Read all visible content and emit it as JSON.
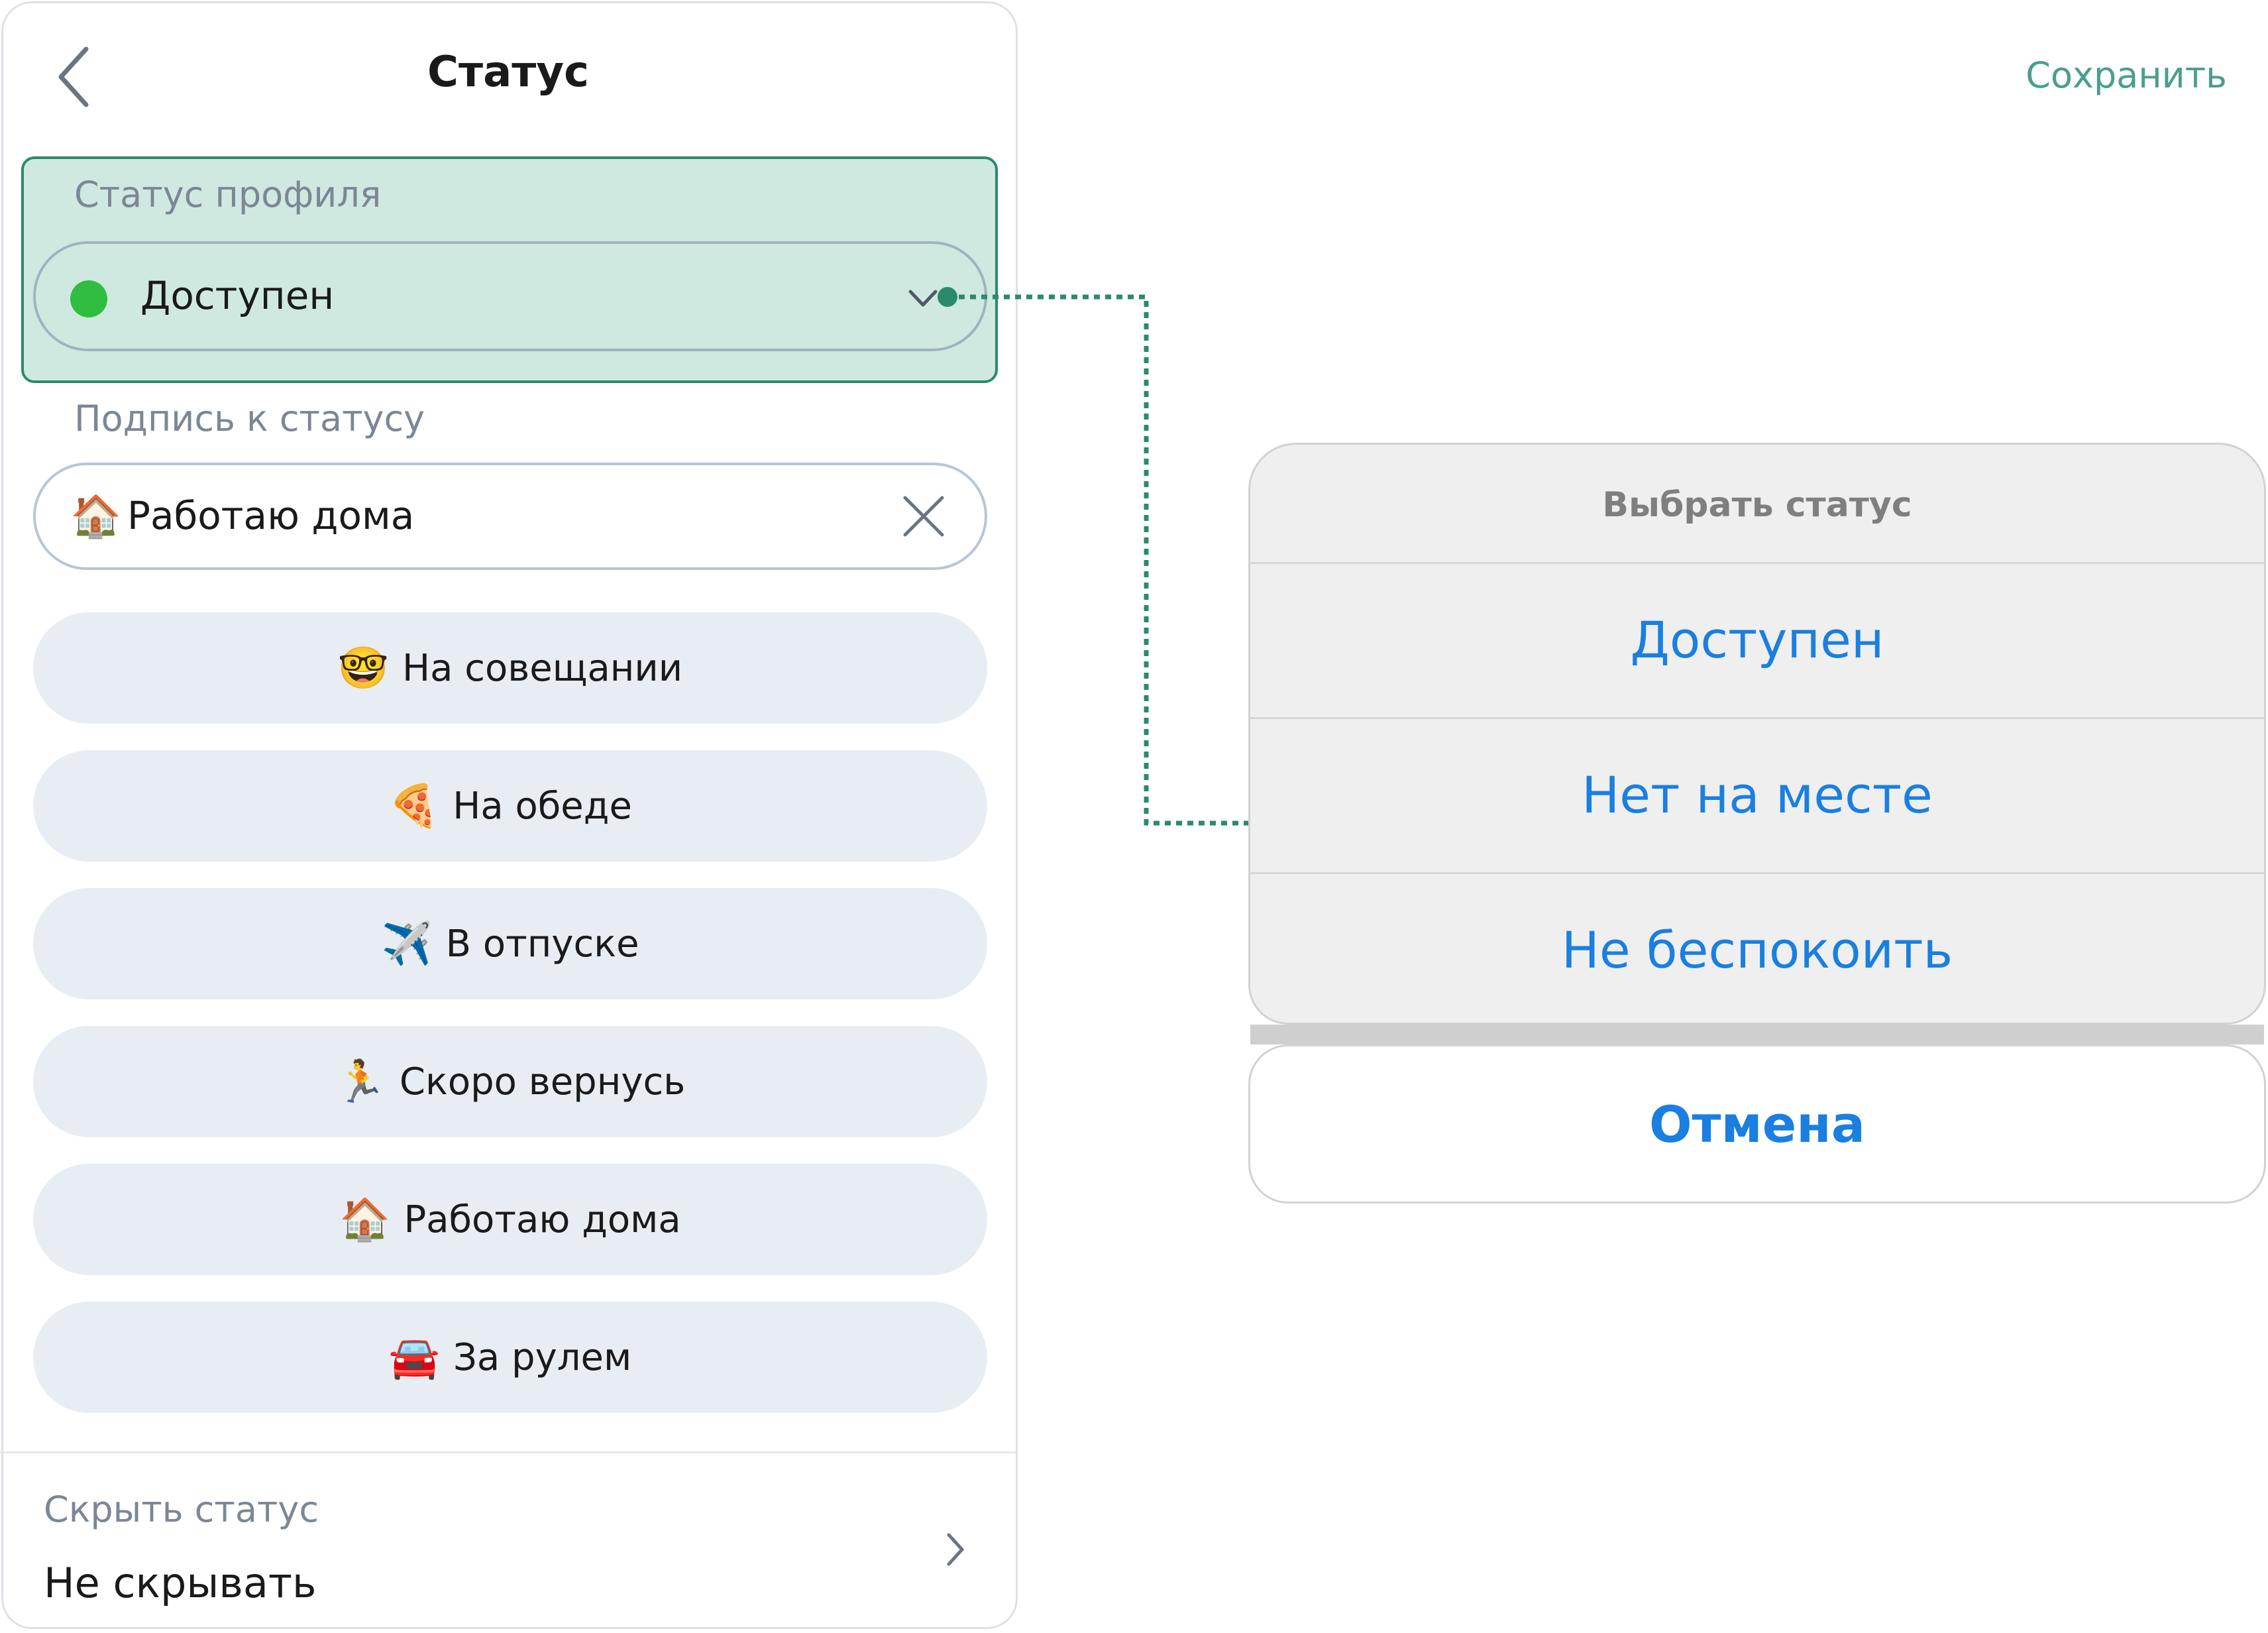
{
  "header": {
    "title": "Статус",
    "save_label": "Сохранить"
  },
  "profile_status": {
    "label": "Статус профиля",
    "value": "Доступен",
    "dot_color": "#2fbe3f"
  },
  "caption": {
    "label": "Подпись к статусу",
    "emoji": "🏠",
    "value": "Работаю дома"
  },
  "presets": [
    {
      "emoji": "🤓",
      "label": "На совещании"
    },
    {
      "emoji": "🍕",
      "label": "На обеде"
    },
    {
      "emoji": "✈️",
      "label": "В отпуске"
    },
    {
      "emoji": "🏃",
      "label": "Скоро вернусь"
    },
    {
      "emoji": "🏠",
      "label": "Работаю дома"
    },
    {
      "emoji": "🚘",
      "label": "За рулем"
    }
  ],
  "hide_status": {
    "label": "Скрыть статус",
    "value": "Не скрывать"
  },
  "sheet": {
    "title": "Выбрать статус",
    "options": [
      "Доступен",
      "Нет на месте",
      "Не беспокоить"
    ],
    "cancel_label": "Отмена"
  },
  "colors": {
    "accent": "#4a9e8c",
    "highlight_fill": "#cfe9e1",
    "highlight_border": "#2a8a6c",
    "action_blue": "#1a7fe0",
    "preset_fill": "#e8edf3"
  }
}
